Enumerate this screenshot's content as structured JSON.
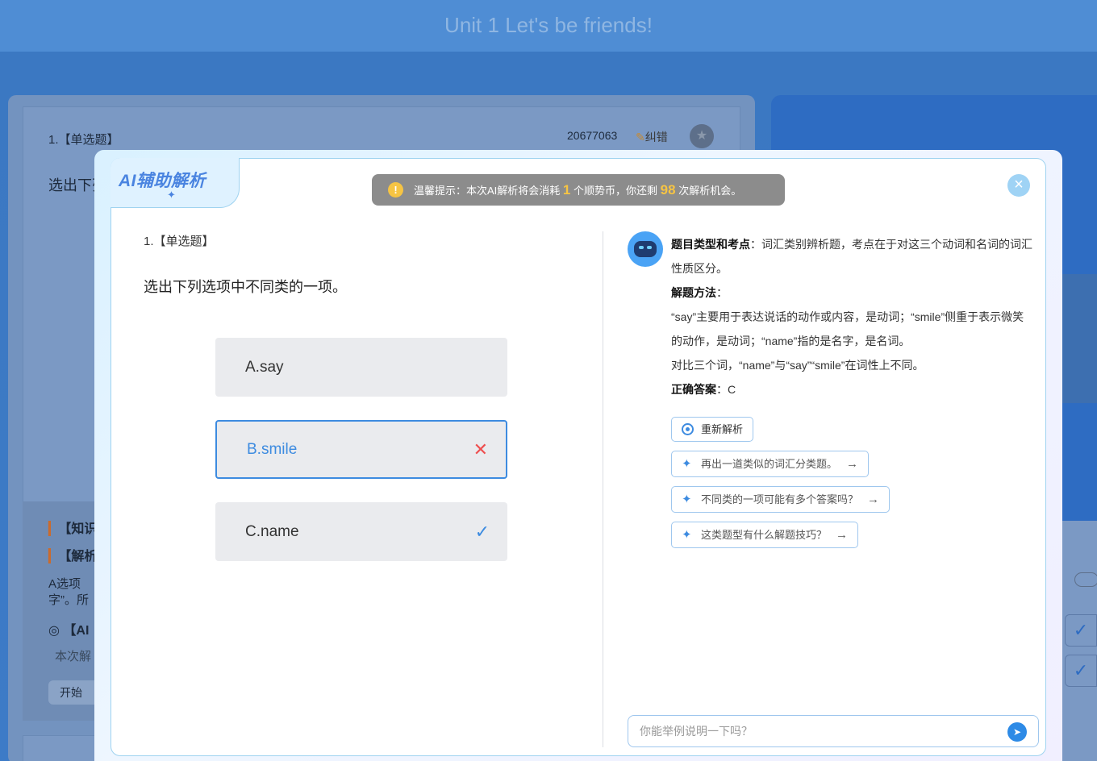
{
  "page": {
    "title": "Unit 1 Let's be friends!"
  },
  "background": {
    "question_no": "1.【单选题】",
    "question_id": "20677063",
    "fix_label": "纠错",
    "question_text": "选出下列",
    "knowledge_label": "【知识",
    "analysis_label": "【解析",
    "analysis_text_1": "A选项",
    "analysis_text_2": "字”。所",
    "ai_label": "【AI",
    "ai_text": "本次解",
    "start_label": "开始"
  },
  "modal": {
    "logo": "AI辅助解析",
    "notice": {
      "prefix": "温馨提示：本次AI解析将会消耗",
      "cost": "1",
      "mid": "个顺势币，你还剩",
      "remain": "98",
      "suffix": "次解析机会。"
    },
    "close_icon": "×",
    "question": {
      "number": "1.【单选题】",
      "text": "选出下列选项中不同类的一项。",
      "options": [
        {
          "label": "A.say",
          "state": "normal"
        },
        {
          "label": "B.smile",
          "state": "wrong"
        },
        {
          "label": "C.name",
          "state": "correct"
        }
      ]
    },
    "analysis": {
      "type_label": "题目类型和考点",
      "type_text": "：词汇类别辨析题，考点在于对这三个动词和名词的词汇性质区分。",
      "method_label": "解题方法",
      "method_colon": "：",
      "method_line1": "“say”主要用于表达说话的动作或内容，是动词；“smile”侧重于表示微笑的动作，是动词；“name”指的是名字，是名词。",
      "method_line2": "对比三个词，“name”与“say”“smile”在词性上不同。",
      "answer_label": "正确答案",
      "answer_text": "：C"
    },
    "reanalyze_label": "重新解析",
    "suggestions": [
      "再出一道类似的词汇分类题。",
      "不同类的一项可能有多个答案吗？",
      "这类题型有什么解题技巧？"
    ],
    "ask": {
      "placeholder": "你能举例说明一下吗？",
      "value": ""
    }
  },
  "colors": {
    "accent": "#3d8be0",
    "wrong": "#ee4e4e",
    "notice_highlight": "#f6c443"
  }
}
